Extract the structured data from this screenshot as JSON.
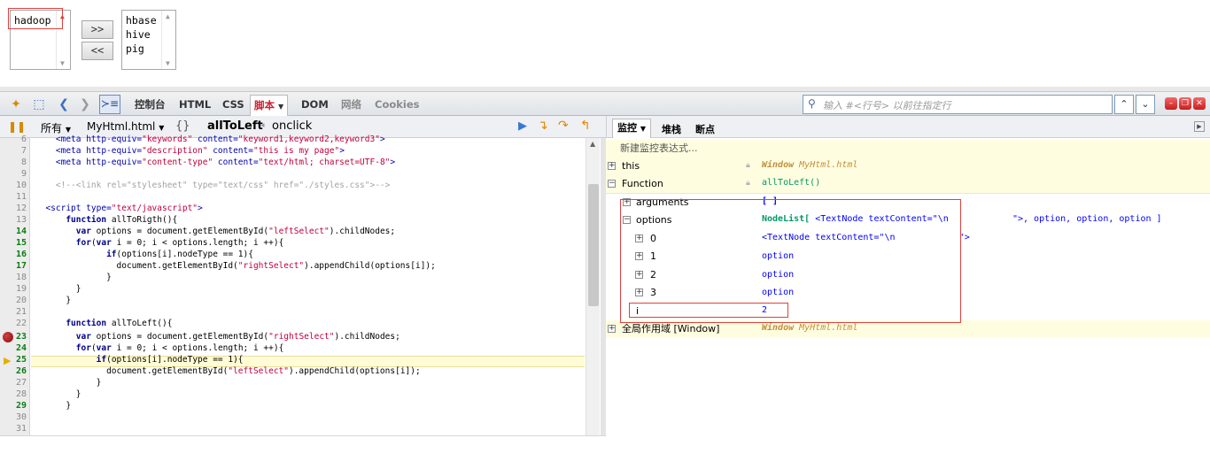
{
  "demo": {
    "left_select": [
      "hadoop"
    ],
    "right_select": [
      "hbase",
      "hive",
      "pig"
    ],
    "to_right_button": ">>",
    "to_left_button": "<<"
  },
  "toolbar": {
    "tabs": [
      "控制台",
      "HTML",
      "CSS",
      "脚本",
      "DOM",
      "网络",
      "Cookies"
    ],
    "active_tab": "脚本",
    "command_placeholder": "输入 #<行号> 以前往指定行"
  },
  "script_bar": {
    "filter": "所有",
    "file": "MyHtml.html",
    "braces": "{}",
    "stack_function": "allToLeft",
    "stack_event": "onclick"
  },
  "watch_tabs": [
    "监控",
    "堆栈",
    "断点"
  ],
  "code": {
    "lines": [
      {
        "n": "6",
        "text": "    <meta http-equiv=\"keywords\" content=\"keyword1,keyword2,keyword3\">"
      },
      {
        "n": "7",
        "text": "    <meta http-equiv=\"description\" content=\"this is my page\">"
      },
      {
        "n": "8",
        "text": "    <meta http-equiv=\"content-type\" content=\"text/html; charset=UTF-8\">"
      },
      {
        "n": "9",
        "text": ""
      },
      {
        "n": "10",
        "text": "    <!--<link rel=\"stylesheet\" type=\"text/css\" href=\"./styles.css\">-->"
      },
      {
        "n": "11",
        "text": ""
      },
      {
        "n": "12",
        "text": "  <script type=\"text/javascript\">"
      },
      {
        "n": "13",
        "text": "      function allToRigth(){"
      },
      {
        "n": "14",
        "text": "        var options = document.getElementById(\"leftSelect\").childNodes;"
      },
      {
        "n": "15",
        "text": "        for(var i = 0; i < options.length; i ++){"
      },
      {
        "n": "16",
        "text": "              if(options[i].nodeType == 1){"
      },
      {
        "n": "17",
        "text": "                document.getElementById(\"rightSelect\").appendChild(options[i]);"
      },
      {
        "n": "18",
        "text": "              }"
      },
      {
        "n": "19",
        "text": "        }"
      },
      {
        "n": "20",
        "text": "      }"
      },
      {
        "n": "21",
        "text": ""
      },
      {
        "n": "22",
        "text": "      function allToLeft(){"
      },
      {
        "n": "23",
        "text": "        var options = document.getElementById(\"rightSelect\").childNodes;"
      },
      {
        "n": "24",
        "text": "        for(var i = 0; i < options.length; i ++){"
      },
      {
        "n": "25",
        "text": "            if(options[i].nodeType == 1){"
      },
      {
        "n": "26",
        "text": "              document.getElementById(\"leftSelect\").appendChild(options[i]);"
      },
      {
        "n": "27",
        "text": "            }"
      },
      {
        "n": "28",
        "text": "        }"
      },
      {
        "n": "29",
        "text": "      }"
      },
      {
        "n": "30",
        "text": ""
      },
      {
        "n": "31",
        "text": ""
      }
    ],
    "breakpoint_line": "23",
    "current_line": "25"
  },
  "watch": {
    "new_expression": "新建监控表达式...",
    "this_label": "this",
    "this_value_obj": "Window",
    "this_value_file": "MyHtml.html",
    "function_label": "Function",
    "function_value": "allToLeft()",
    "arguments_label": "arguments",
    "arguments_value": "[ ]",
    "options_label": "options",
    "options_value_type": "NodeList[",
    "options_value_rest": "<TextNode textContent=\"\\n            \">, option, option, option ]",
    "items": [
      {
        "key": "0",
        "value": "<TextNode textContent=\"\\n            \">"
      },
      {
        "key": "1",
        "value": "option"
      },
      {
        "key": "2",
        "value": "option"
      },
      {
        "key": "3",
        "value": "option"
      }
    ],
    "i_label": "i",
    "i_value": "2",
    "global_label": "全局作用域 [Window]",
    "global_value_obj": "Window",
    "global_value_file": "MyHtml.html"
  }
}
